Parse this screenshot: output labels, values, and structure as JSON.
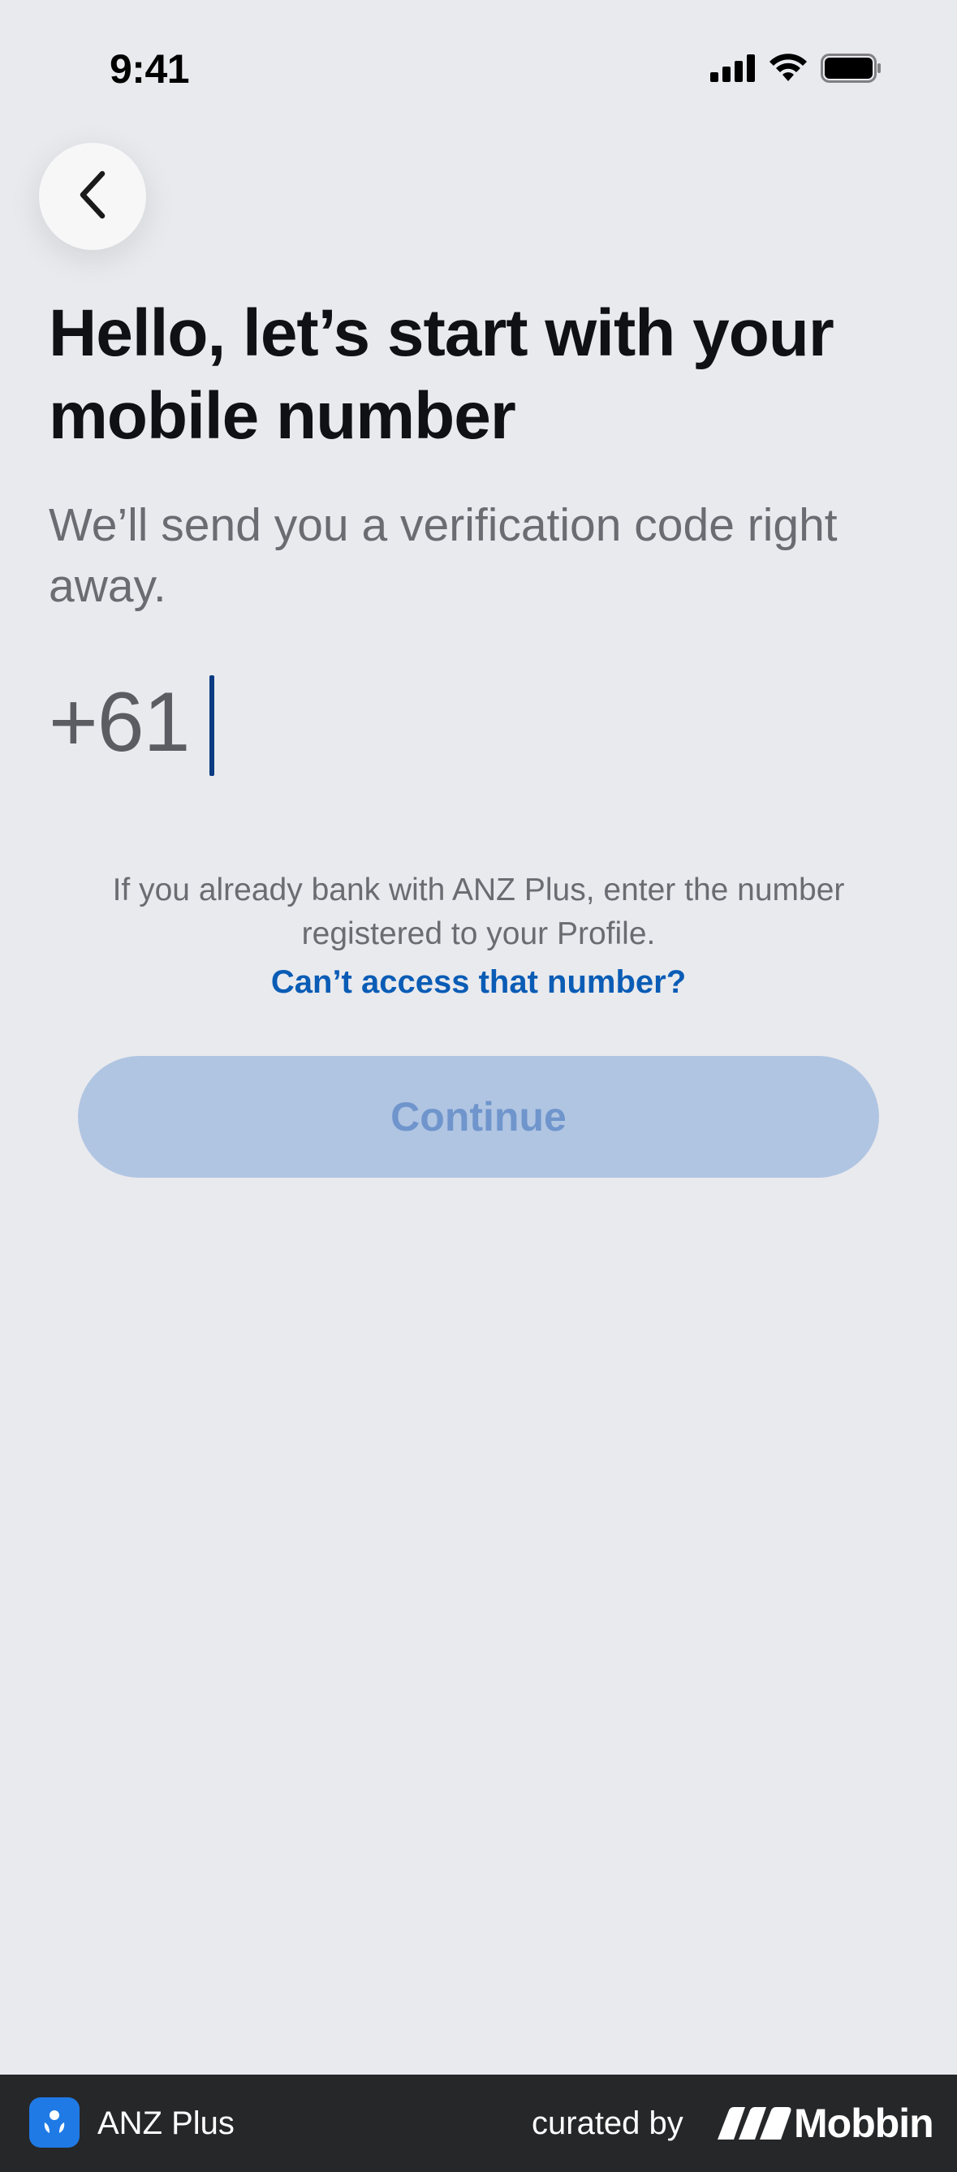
{
  "status_bar": {
    "time": "9:41",
    "icons": [
      "signal-icon",
      "wifi-icon",
      "battery-icon"
    ]
  },
  "header": {
    "back_icon": "chevron-left-icon"
  },
  "main": {
    "title": "Hello, let’s start with your mobile number",
    "subtitle": "We’ll send you a verification code right away.",
    "phone": {
      "country_code": "+61",
      "value": "",
      "placeholder": ""
    },
    "hint": "If you already bank with ANZ Plus, enter the number registered to your Profile.",
    "link_label": "Can’t access that number?",
    "continue_label": "Continue"
  },
  "footer": {
    "app_name": "ANZ Plus",
    "curated_label": "curated by",
    "brand_name": "Mobbin"
  },
  "colors": {
    "background": "#e9eaee",
    "accent_link": "#0a5cb5",
    "button_disabled_bg": "#b0c5e2",
    "button_disabled_text": "#6f95cc",
    "caret": "#0b3b82",
    "footer_bg": "#262729",
    "app_logo_bg": "#1f7ae6"
  }
}
